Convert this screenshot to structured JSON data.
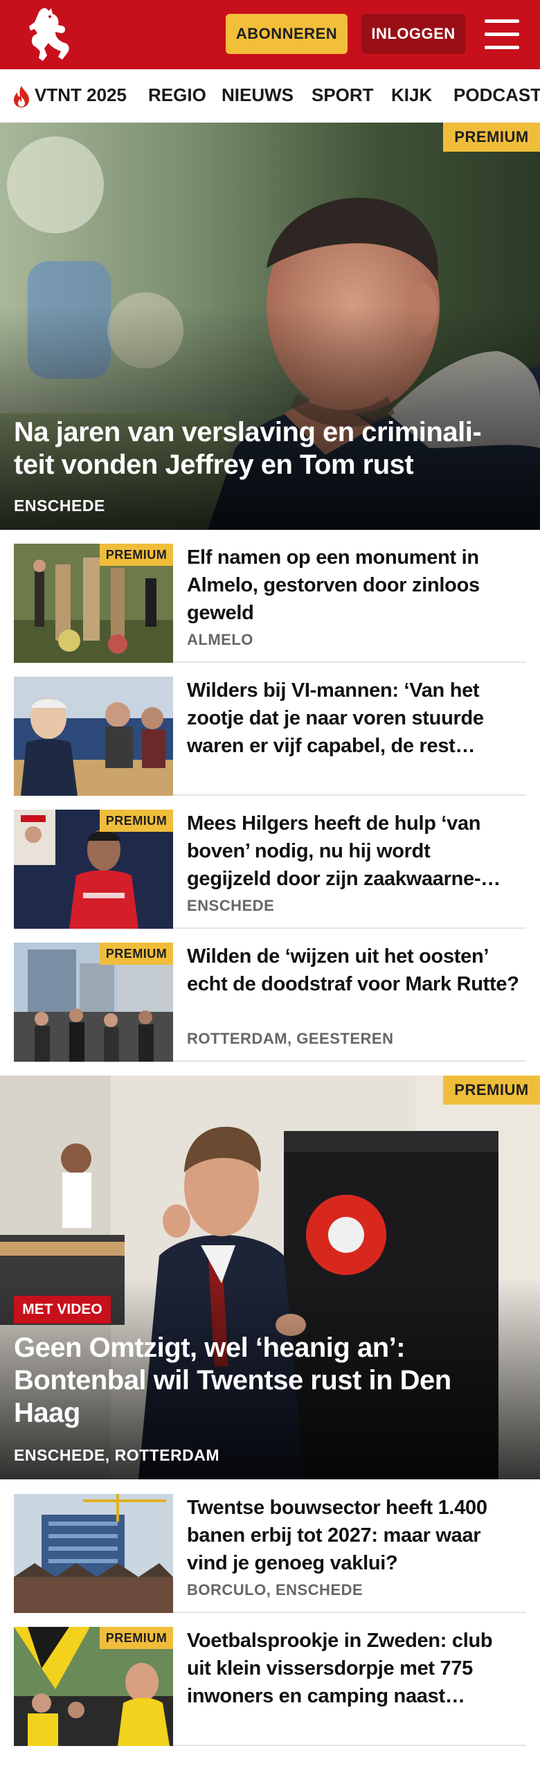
{
  "header": {
    "subscribe_label": "ABONNEREN",
    "login_label": "INLOGGEN",
    "brand_color": "#c8101c"
  },
  "nav": {
    "items": [
      "VTNT 2025",
      "REGIO",
      "NIEUWS",
      "SPORT",
      "KIJK",
      "PODCAST"
    ]
  },
  "hero1": {
    "badge": "PREMIUM",
    "title": "Na jaren van verslaving en criminali-teit vonden Jeffrey en Tom rust",
    "location": "ENSCHEDE"
  },
  "articles": [
    {
      "premium": "PREMIUM",
      "title": "Elf namen op een monument in Almelo, gestorven door zinloos geweld",
      "location": "ALMELO"
    },
    {
      "premium": "",
      "title": "Wilders bij VI-mannen: ‘Van het zootje dat je naar voren stuurde waren er vijf capabel, de rest…",
      "location": ""
    },
    {
      "premium": "PREMIUM",
      "title": "Mees Hilgers heeft de hulp ‘van boven’ nodig, nu hij wordt gegijzeld door zijn zaakwaarne-…",
      "location": "ENSCHEDE"
    },
    {
      "premium": "PREMIUM",
      "title": "Wilden de ‘wijzen uit het oosten’ echt de doodstraf voor Mark Rutte?",
      "location": "ROTTERDAM, GEESTEREN"
    }
  ],
  "hero2": {
    "badge": "PREMIUM",
    "video_badge": "MET VIDEO",
    "title": "Geen Omtzigt, wel ‘heanig an’: Bontenbal wil Twentse rust in Den Haag",
    "location": "ENSCHEDE, ROTTERDAM"
  },
  "articles2": [
    {
      "premium": "",
      "title": "Twentse bouwsector heeft 1.400 banen erbij tot 2027: maar waar vind je genoeg vaklui?",
      "location": "BORCULO, ENSCHEDE"
    },
    {
      "premium": "PREMIUM",
      "title": "Voetbalsprookje in Zweden: club uit klein vissersdorpje met 775 inwoners en camping naast…",
      "location": ""
    }
  ]
}
